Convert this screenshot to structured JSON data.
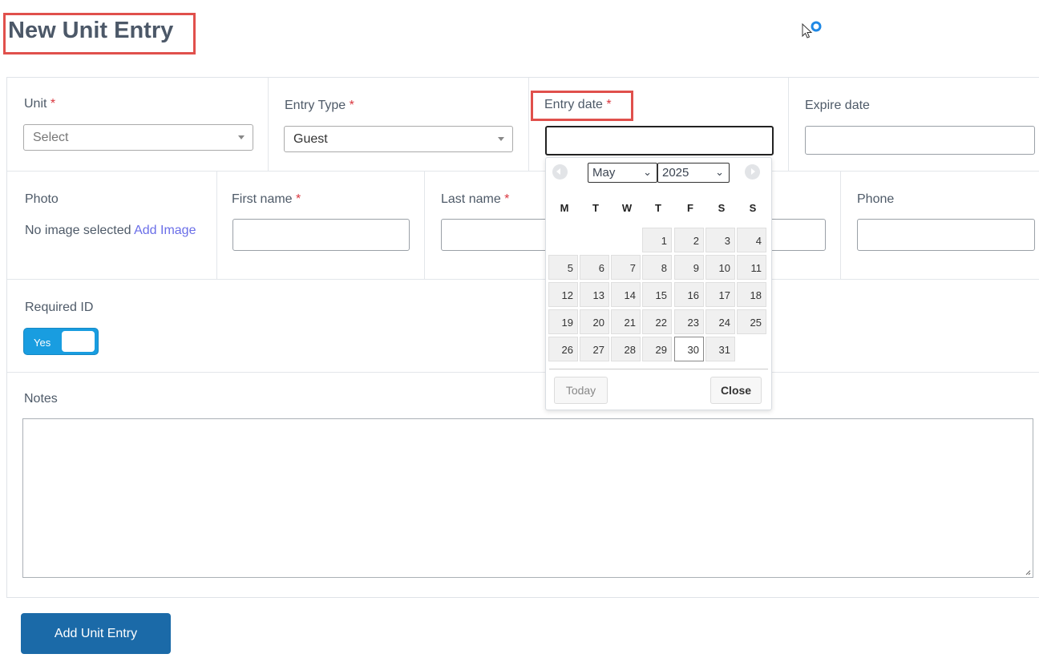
{
  "page": {
    "title": "New Unit Entry"
  },
  "fields": {
    "unit": {
      "label": "Unit",
      "placeholder": "Select"
    },
    "entry_type": {
      "label": "Entry Type",
      "value": "Guest"
    },
    "entry_date": {
      "label": "Entry date",
      "value": ""
    },
    "expire_date": {
      "label": "Expire date",
      "value": ""
    },
    "photo": {
      "label": "Photo",
      "status": "No image selected",
      "link": "Add Image"
    },
    "first_name": {
      "label": "First name",
      "value": ""
    },
    "last_name": {
      "label": "Last name",
      "value": ""
    },
    "phone": {
      "label": "Phone",
      "value": ""
    },
    "required_id": {
      "label": "Required ID",
      "toggle_label": "Yes",
      "on": true
    },
    "notes": {
      "label": "Notes",
      "value": ""
    }
  },
  "required_marker": "*",
  "datepicker": {
    "month": "May",
    "year": "2025",
    "weekdays": [
      "M",
      "T",
      "W",
      "T",
      "F",
      "S",
      "S"
    ],
    "days": [
      1,
      2,
      3,
      4,
      5,
      6,
      7,
      8,
      9,
      10,
      11,
      12,
      13,
      14,
      15,
      16,
      17,
      18,
      19,
      20,
      21,
      22,
      23,
      24,
      25,
      26,
      27,
      28,
      29,
      30,
      31
    ],
    "first_weekday_index": 3,
    "current_day": 30,
    "today_label": "Today",
    "close_label": "Close"
  },
  "submit_label": "Add Unit Entry",
  "colors": {
    "accent": "#1b6aa8",
    "toggle": "#199de0",
    "required": "#d9363e",
    "highlight": "#e0504c",
    "link": "#6a6ee8"
  }
}
